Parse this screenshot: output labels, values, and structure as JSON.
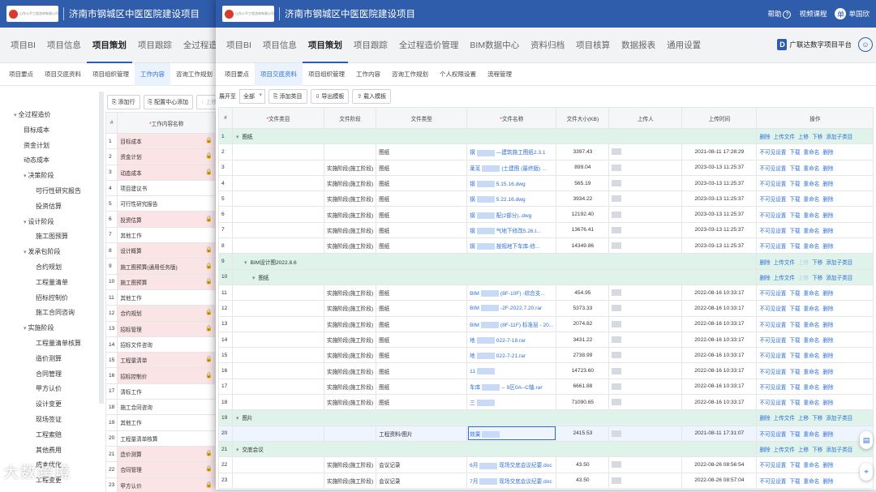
{
  "app": {
    "project_title": "济南市钢城区中医医院建设项目",
    "logo_text": "山东公平工程咨询有限公司",
    "header_right": {
      "help": "帮助",
      "video": "视频课程",
      "user": "单国欣",
      "avatar_initial": "单"
    },
    "platform": "广联达数字项目平台",
    "platform_initial": "D"
  },
  "main_tabs": [
    "项目BI",
    "项目信息",
    "项目策划",
    "项目跟踪",
    "全过程造价管理",
    "BIM数据中心",
    "资料归档",
    "项目核算",
    "数据报表",
    "通用设置"
  ],
  "left_window": {
    "main_tabs": [
      "项目BI",
      "项目信息",
      "项目策划",
      "项目跟踪",
      "全过程造价"
    ],
    "sub_tabs": [
      "项目要点",
      "项目交底资料",
      "项目组织管理",
      "工作内容",
      "咨询工作规划"
    ],
    "toolbar": {
      "add_row": "添加行",
      "config_center": "配置中心添加",
      "move_up": "上移"
    },
    "table_header": {
      "col_index": "#",
      "col_name": "工作内容名称"
    },
    "tree": [
      {
        "label": "全过程造价",
        "level": 1,
        "caret": "▾"
      },
      {
        "label": "目标成本",
        "level": 2,
        "caret": ""
      },
      {
        "label": "资金计划",
        "level": 2,
        "caret": ""
      },
      {
        "label": "动态成本",
        "level": 2,
        "caret": ""
      },
      {
        "label": "决策阶段",
        "level": 2,
        "caret": "▾"
      },
      {
        "label": "可行性研究报告",
        "level": 3,
        "caret": ""
      },
      {
        "label": "投资估算",
        "level": 3,
        "caret": ""
      },
      {
        "label": "设计阶段",
        "level": 2,
        "caret": "▾"
      },
      {
        "label": "施工图预算",
        "level": 3,
        "caret": ""
      },
      {
        "label": "发承包阶段",
        "level": 2,
        "caret": "▾"
      },
      {
        "label": "合约规划",
        "level": 3,
        "caret": ""
      },
      {
        "label": "工程量清单",
        "level": 3,
        "caret": ""
      },
      {
        "label": "招标控制价",
        "level": 3,
        "caret": ""
      },
      {
        "label": "施工合同咨询",
        "level": 3,
        "caret": ""
      },
      {
        "label": "实施阶段",
        "level": 2,
        "caret": "▾"
      },
      {
        "label": "工程量清单核算",
        "level": 3,
        "caret": ""
      },
      {
        "label": "造价测算",
        "level": 3,
        "caret": ""
      },
      {
        "label": "合同管理",
        "level": 3,
        "caret": ""
      },
      {
        "label": "甲方认价",
        "level": 3,
        "caret": ""
      },
      {
        "label": "设计变更",
        "level": 3,
        "caret": ""
      },
      {
        "label": "现场签证",
        "level": 3,
        "caret": ""
      },
      {
        "label": "工程索赔",
        "level": 3,
        "caret": ""
      },
      {
        "label": "其他费用",
        "level": 3,
        "caret": ""
      },
      {
        "label": "成本优化",
        "level": 3,
        "caret": ""
      },
      {
        "label": "工程变更",
        "level": 3,
        "caret": ""
      }
    ],
    "rows": [
      {
        "n": "1",
        "name": "目标成本",
        "pink": true,
        "lock": true
      },
      {
        "n": "2",
        "name": "资金计划",
        "pink": true,
        "lock": true
      },
      {
        "n": "3",
        "name": "动态成本",
        "pink": true,
        "lock": true
      },
      {
        "n": "4",
        "name": "项目建议书",
        "pink": false,
        "lock": false
      },
      {
        "n": "5",
        "name": "可行性研究报告",
        "pink": false,
        "lock": false
      },
      {
        "n": "6",
        "name": "投资估算",
        "pink": true,
        "lock": true
      },
      {
        "n": "7",
        "name": "其他工作",
        "pink": false,
        "lock": false
      },
      {
        "n": "8",
        "name": "设计概算",
        "pink": true,
        "lock": true
      },
      {
        "n": "9",
        "name": "施工图预算(通用任务版)",
        "pink": true,
        "lock": true
      },
      {
        "n": "10",
        "name": "施工图预算",
        "pink": true,
        "lock": true
      },
      {
        "n": "11",
        "name": "其他工作",
        "pink": false,
        "lock": false
      },
      {
        "n": "12",
        "name": "合约规划",
        "pink": true,
        "lock": true
      },
      {
        "n": "13",
        "name": "招标管理",
        "pink": true,
        "lock": true
      },
      {
        "n": "14",
        "name": "招标文件咨询",
        "pink": false,
        "lock": false
      },
      {
        "n": "15",
        "name": "工程量清单",
        "pink": true,
        "lock": true
      },
      {
        "n": "16",
        "name": "招标控制价",
        "pink": true,
        "lock": true
      },
      {
        "n": "17",
        "name": "清标工作",
        "pink": false,
        "lock": false
      },
      {
        "n": "18",
        "name": "施工合同咨询",
        "pink": false,
        "lock": false
      },
      {
        "n": "19",
        "name": "其他工作",
        "pink": false,
        "lock": false
      },
      {
        "n": "20",
        "name": "工程量清单核算",
        "pink": false,
        "lock": false
      },
      {
        "n": "21",
        "name": "造价测算",
        "pink": true,
        "lock": true
      },
      {
        "n": "22",
        "name": "合同管理",
        "pink": true,
        "lock": true
      },
      {
        "n": "23",
        "name": "甲方认价",
        "pink": true,
        "lock": true
      }
    ]
  },
  "right_window": {
    "sub_tabs": [
      "项目要点",
      "项目交底资料",
      "项目组织管理",
      "工作内容",
      "咨询工作规划",
      "个人权限设置",
      "流程管理"
    ],
    "toolbar": {
      "expand_label": "展开至",
      "expand_value": "全部",
      "add_category": "添加类目",
      "export_template": "导出模板",
      "import_template": "载入模板"
    },
    "columns": [
      "#",
      "文件类目",
      "文件阶段",
      "文件类型",
      "文件名称",
      "文件大小(KB)",
      "上传人",
      "上传时间",
      "操作"
    ],
    "ops_group": [
      "删除",
      "上传文件",
      "上移",
      "下移",
      "添加子类目"
    ],
    "ops_file": [
      "不可见设置",
      "下载",
      "重命名",
      "删除"
    ],
    "rows": [
      {
        "n": "1",
        "kind": "group",
        "cat": "图纸",
        "indent": 0,
        "ops_disabled": []
      },
      {
        "n": "2",
        "kind": "file",
        "stage": "",
        "type": "图纸",
        "file_a": "钢",
        "file_b": "—建筑施工图纸2.3.1",
        "size": "3397.43",
        "time": "2021-08-11 17:28:29"
      },
      {
        "n": "3",
        "kind": "file",
        "stage": "实施阶段(施工阶段)",
        "type": "图纸",
        "file_a": "莱芜",
        "file_b": "(土建图 (最终版) ...",
        "size": "899.04",
        "time": "2023-03-13 11:25:37"
      },
      {
        "n": "4",
        "kind": "file",
        "stage": "实施阶段(施工阶段)",
        "type": "图纸",
        "file_a": "钢",
        "file_b": "5.15.16.dwg",
        "size": "565.19",
        "time": "2023-03-13 11:25:37"
      },
      {
        "n": "5",
        "kind": "file",
        "stage": "实施阶段(施工阶段)",
        "type": "图纸",
        "file_a": "钢",
        "file_b": "5.22.16.dwg",
        "size": "3934.22",
        "time": "2023-03-13 11:25:37"
      },
      {
        "n": "6",
        "kind": "file",
        "stage": "实施阶段(施工阶段)",
        "type": "图纸",
        "file_a": "钢",
        "file_b": "配(2部分)..dwg",
        "size": "12192.40",
        "time": "2023-03-13 11:25:37"
      },
      {
        "n": "7",
        "kind": "file",
        "stage": "实施阶段(施工阶段)",
        "type": "图纸",
        "file_a": "钢",
        "file_b": "气地下修改5.26.t...",
        "size": "13676.41",
        "time": "2023-03-13 11:25:37"
      },
      {
        "n": "8",
        "kind": "file",
        "stage": "实施阶段(施工阶段)",
        "type": "图纸",
        "file_a": "钢",
        "file_b": "按规地下车库-修...",
        "size": "14349.86",
        "time": "2023-03-13 11:25:37"
      },
      {
        "n": "9",
        "kind": "group",
        "cat": "BIM设计图2022.8.6",
        "indent": 1,
        "ops_disabled": [
          "上移"
        ]
      },
      {
        "n": "10",
        "kind": "group",
        "cat": "图纸",
        "indent": 2,
        "ops_disabled": [
          "上移"
        ]
      },
      {
        "n": "11",
        "kind": "file",
        "stage": "实施阶段(施工阶段)",
        "type": "图纸",
        "file_a": "BIM",
        "file_b": "(8F-10F) -综合支...",
        "size": "454.95",
        "time": "2022-08-16 10:33:17"
      },
      {
        "n": "12",
        "kind": "file",
        "stage": "实施阶段(施工阶段)",
        "type": "图纸",
        "file_a": "BIM",
        "file_b": "-2F-2022.7.20.rar",
        "size": "5373.33",
        "time": "2022-08-16 10:33:17"
      },
      {
        "n": "13",
        "kind": "file",
        "stage": "实施阶段(施工阶段)",
        "type": "图纸",
        "file_a": "BIM",
        "file_b": "(8F-11F) 标准层 - 20...",
        "size": "2074.82",
        "time": "2022-08-16 10:33:17"
      },
      {
        "n": "14",
        "kind": "file",
        "stage": "实施阶段(施工阶段)",
        "type": "图纸",
        "file_a": "地",
        "file_b": "022-7-18.rar",
        "size": "3431.22",
        "time": "2022-08-16 10:33:17"
      },
      {
        "n": "15",
        "kind": "file",
        "stage": "实施阶段(施工阶段)",
        "type": "图纸",
        "file_a": "地",
        "file_b": "022-7-21.rar",
        "size": "2738.99",
        "time": "2022-08-16 10:33:17"
      },
      {
        "n": "16",
        "kind": "file",
        "stage": "实施阶段(施工阶段)",
        "type": "图纸",
        "file_a": "11",
        "file_b": "",
        "size": "14723.60",
        "time": "2022-08-16 10:33:17"
      },
      {
        "n": "17",
        "kind": "file",
        "stage": "实施阶段(施工阶段)",
        "type": "图纸",
        "file_a": "车库",
        "file_b": "-- 9区0A--C轴.rar",
        "size": "6661.88",
        "time": "2022-08-16 10:33:17"
      },
      {
        "n": "18",
        "kind": "file",
        "stage": "实施阶段(施工阶段)",
        "type": "图纸",
        "file_a": "三",
        "file_b": "",
        "size": "71090.65",
        "time": "2022-08-16 10:33:17"
      },
      {
        "n": "19",
        "kind": "group",
        "cat": "图片",
        "indent": 0,
        "ops_disabled": []
      },
      {
        "n": "20",
        "kind": "file",
        "stage": "",
        "type": "工程资料/图片",
        "file_a": "效果",
        "file_b": "",
        "size": "2415.53",
        "time": "2021-08-11 17:31:07",
        "selected": true
      },
      {
        "n": "21",
        "kind": "group",
        "cat": "交底会议",
        "indent": 0,
        "ops_disabled": []
      },
      {
        "n": "22",
        "kind": "file",
        "stage": "实施阶段(施工阶段)",
        "type": "会议记录",
        "file_a": "6月",
        "file_b": "现场交底会议纪要.doc",
        "size": "43.50",
        "time": "2022-08-26 08:56:54"
      },
      {
        "n": "23",
        "kind": "file",
        "stage": "实施阶段(施工阶段)",
        "type": "会议记录",
        "file_a": "7月",
        "file_b": "现场交底会议纪要.doc",
        "size": "43.50",
        "time": "2022-08-26 08:57:04"
      }
    ]
  },
  "watermark": "大数跨境"
}
